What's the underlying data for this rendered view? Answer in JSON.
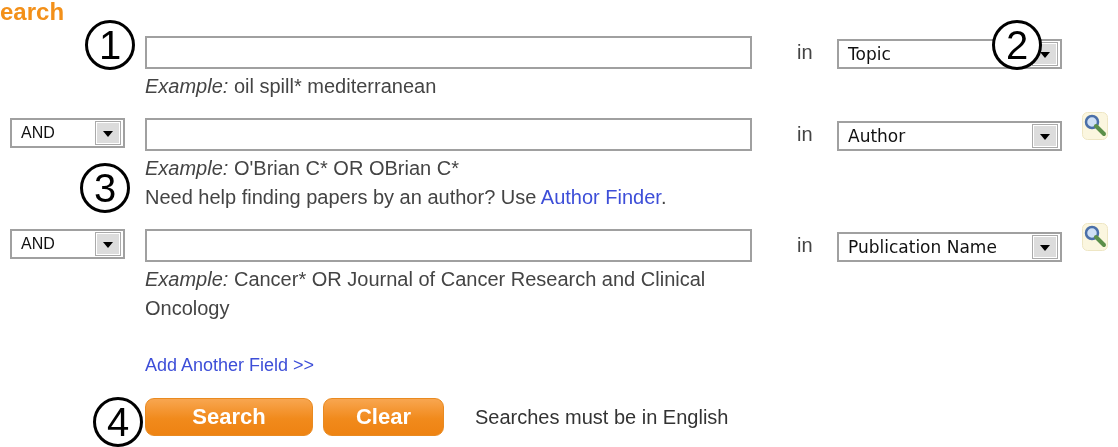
{
  "heading": "earch",
  "rows": [
    {
      "operator": null,
      "in_label": "in",
      "field": "Topic",
      "has_lookup": false,
      "hints": [
        {
          "kind": "example",
          "text": "*Example:* oil spill* mediterranean"
        }
      ]
    },
    {
      "operator": "AND",
      "in_label": "in",
      "field": "Author",
      "has_lookup": true,
      "hints": [
        {
          "kind": "example",
          "text": "*Example:* O'Brian C* OR OBrian C*"
        },
        {
          "kind": "help",
          "text": "Need help finding papers by an author? Use",
          "link": "Author Finder",
          "after": "."
        }
      ]
    },
    {
      "operator": "AND",
      "in_label": "in",
      "field": "Publication Name",
      "has_lookup": true,
      "hints": [
        {
          "kind": "example",
          "text": "*Example:* Cancer* OR Journal of Cancer Research and Clinical Oncology"
        }
      ]
    }
  ],
  "add_field_link": "Add Another Field >>",
  "buttons": [
    "Search",
    "Clear"
  ],
  "note": "Searches must be in English",
  "callouts": [
    "1",
    "2",
    "3",
    "4"
  ]
}
